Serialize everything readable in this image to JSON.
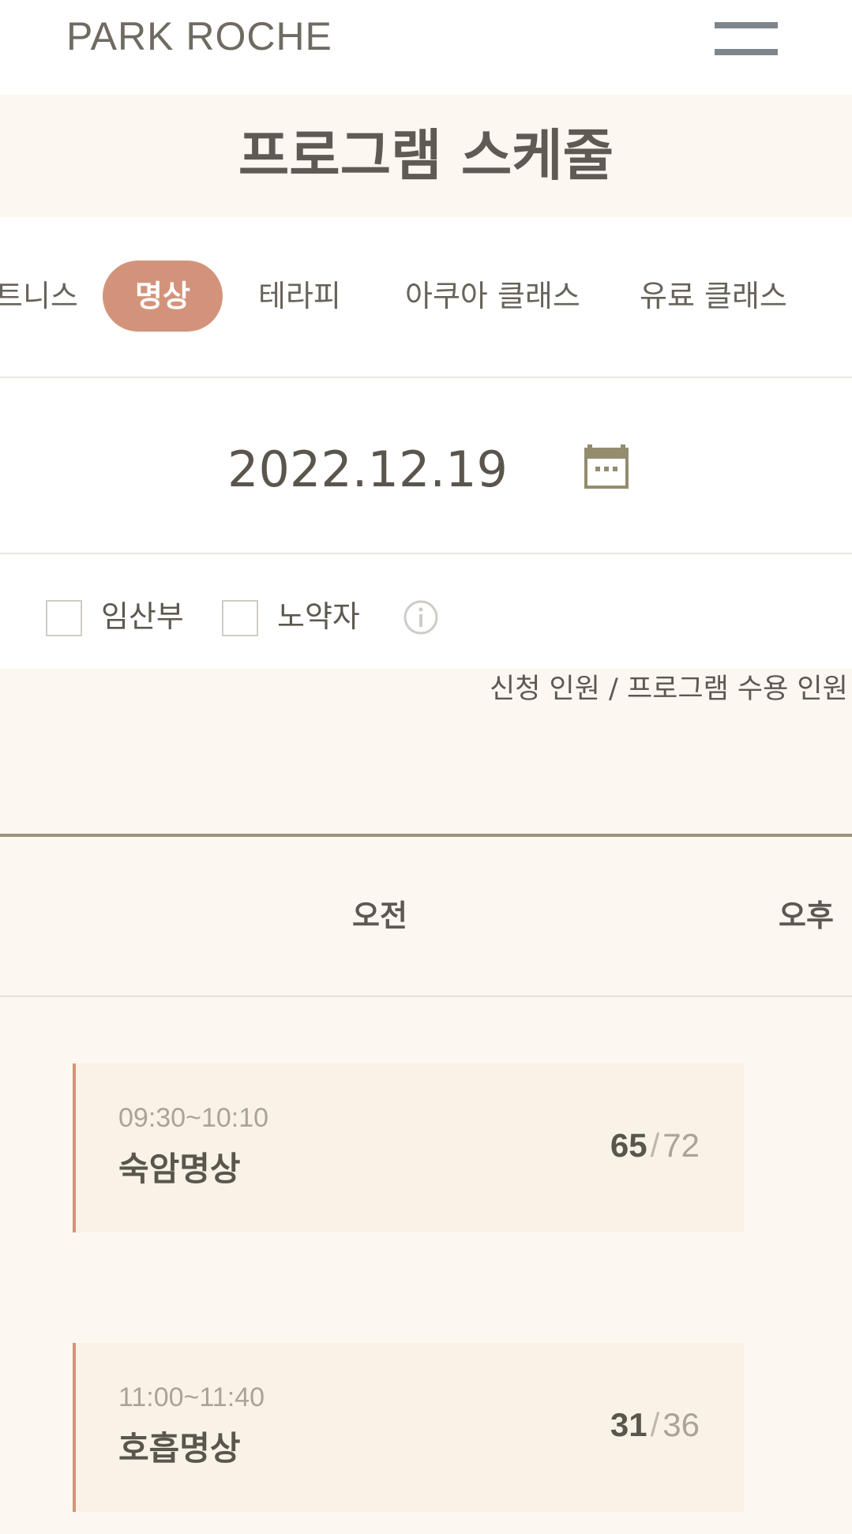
{
  "header": {
    "logo_text": "PARK ROCHE",
    "menu_icon": "hamburger-menu-icon"
  },
  "page_title": "프로그램 스케줄",
  "tabs": [
    {
      "label": "트니스",
      "active": false
    },
    {
      "label": "명상",
      "active": true
    },
    {
      "label": "테라피",
      "active": false
    },
    {
      "label": "아쿠아 클래스",
      "active": false
    },
    {
      "label": "유료 클래스",
      "active": false
    }
  ],
  "date": {
    "value": "2022.12.19",
    "calendar_icon": "calendar-icon"
  },
  "filters": {
    "pregnant": {
      "label": "임산부",
      "checked": false
    },
    "elderly": {
      "label": "노약자",
      "checked": false
    },
    "info_icon": "info-icon"
  },
  "capacity_note": "신청 인원 / 프로그램 수용 인원",
  "periods": {
    "am": "오전",
    "pm": "오후"
  },
  "programs": [
    {
      "time": "09:30~10:10",
      "name": "숙암명상",
      "registered": "65",
      "capacity": "72"
    },
    {
      "time": "11:00~11:40",
      "name": "호흡명상",
      "registered": "31",
      "capacity": "36"
    }
  ],
  "colors": {
    "accent": "#d3937b",
    "cream_bg": "#fcf7f0",
    "card_bg": "#f9f2e7",
    "text": "#5a554d",
    "rule": "#9d927a"
  }
}
